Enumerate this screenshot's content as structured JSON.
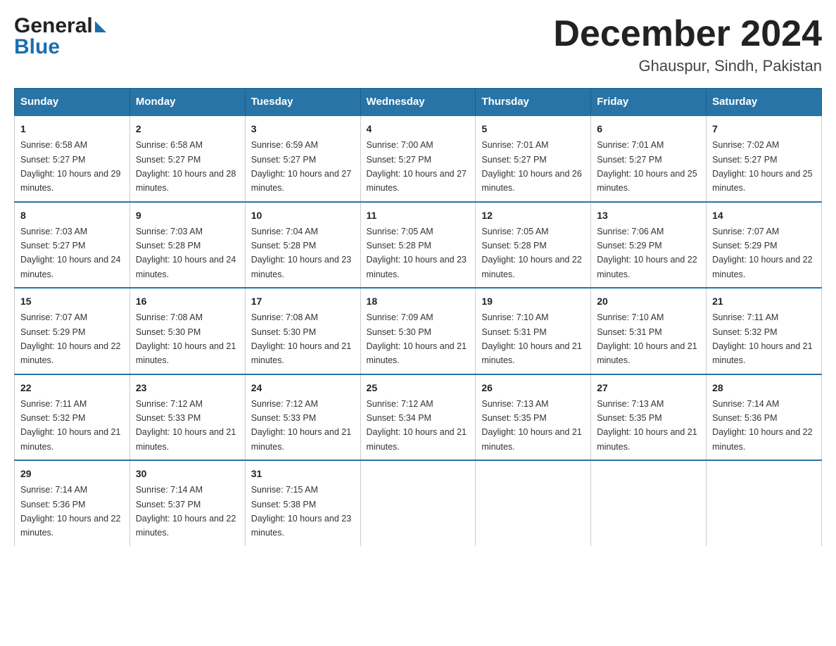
{
  "logo": {
    "general": "General",
    "blue": "Blue"
  },
  "title": "December 2024",
  "subtitle": "Ghauspur, Sindh, Pakistan",
  "days_header": [
    "Sunday",
    "Monday",
    "Tuesday",
    "Wednesday",
    "Thursday",
    "Friday",
    "Saturday"
  ],
  "weeks": [
    [
      {
        "num": "1",
        "sunrise": "6:58 AM",
        "sunset": "5:27 PM",
        "daylight": "10 hours and 29 minutes."
      },
      {
        "num": "2",
        "sunrise": "6:58 AM",
        "sunset": "5:27 PM",
        "daylight": "10 hours and 28 minutes."
      },
      {
        "num": "3",
        "sunrise": "6:59 AM",
        "sunset": "5:27 PM",
        "daylight": "10 hours and 27 minutes."
      },
      {
        "num": "4",
        "sunrise": "7:00 AM",
        "sunset": "5:27 PM",
        "daylight": "10 hours and 27 minutes."
      },
      {
        "num": "5",
        "sunrise": "7:01 AM",
        "sunset": "5:27 PM",
        "daylight": "10 hours and 26 minutes."
      },
      {
        "num": "6",
        "sunrise": "7:01 AM",
        "sunset": "5:27 PM",
        "daylight": "10 hours and 25 minutes."
      },
      {
        "num": "7",
        "sunrise": "7:02 AM",
        "sunset": "5:27 PM",
        "daylight": "10 hours and 25 minutes."
      }
    ],
    [
      {
        "num": "8",
        "sunrise": "7:03 AM",
        "sunset": "5:27 PM",
        "daylight": "10 hours and 24 minutes."
      },
      {
        "num": "9",
        "sunrise": "7:03 AM",
        "sunset": "5:28 PM",
        "daylight": "10 hours and 24 minutes."
      },
      {
        "num": "10",
        "sunrise": "7:04 AM",
        "sunset": "5:28 PM",
        "daylight": "10 hours and 23 minutes."
      },
      {
        "num": "11",
        "sunrise": "7:05 AM",
        "sunset": "5:28 PM",
        "daylight": "10 hours and 23 minutes."
      },
      {
        "num": "12",
        "sunrise": "7:05 AM",
        "sunset": "5:28 PM",
        "daylight": "10 hours and 22 minutes."
      },
      {
        "num": "13",
        "sunrise": "7:06 AM",
        "sunset": "5:29 PM",
        "daylight": "10 hours and 22 minutes."
      },
      {
        "num": "14",
        "sunrise": "7:07 AM",
        "sunset": "5:29 PM",
        "daylight": "10 hours and 22 minutes."
      }
    ],
    [
      {
        "num": "15",
        "sunrise": "7:07 AM",
        "sunset": "5:29 PM",
        "daylight": "10 hours and 22 minutes."
      },
      {
        "num": "16",
        "sunrise": "7:08 AM",
        "sunset": "5:30 PM",
        "daylight": "10 hours and 21 minutes."
      },
      {
        "num": "17",
        "sunrise": "7:08 AM",
        "sunset": "5:30 PM",
        "daylight": "10 hours and 21 minutes."
      },
      {
        "num": "18",
        "sunrise": "7:09 AM",
        "sunset": "5:30 PM",
        "daylight": "10 hours and 21 minutes."
      },
      {
        "num": "19",
        "sunrise": "7:10 AM",
        "sunset": "5:31 PM",
        "daylight": "10 hours and 21 minutes."
      },
      {
        "num": "20",
        "sunrise": "7:10 AM",
        "sunset": "5:31 PM",
        "daylight": "10 hours and 21 minutes."
      },
      {
        "num": "21",
        "sunrise": "7:11 AM",
        "sunset": "5:32 PM",
        "daylight": "10 hours and 21 minutes."
      }
    ],
    [
      {
        "num": "22",
        "sunrise": "7:11 AM",
        "sunset": "5:32 PM",
        "daylight": "10 hours and 21 minutes."
      },
      {
        "num": "23",
        "sunrise": "7:12 AM",
        "sunset": "5:33 PM",
        "daylight": "10 hours and 21 minutes."
      },
      {
        "num": "24",
        "sunrise": "7:12 AM",
        "sunset": "5:33 PM",
        "daylight": "10 hours and 21 minutes."
      },
      {
        "num": "25",
        "sunrise": "7:12 AM",
        "sunset": "5:34 PM",
        "daylight": "10 hours and 21 minutes."
      },
      {
        "num": "26",
        "sunrise": "7:13 AM",
        "sunset": "5:35 PM",
        "daylight": "10 hours and 21 minutes."
      },
      {
        "num": "27",
        "sunrise": "7:13 AM",
        "sunset": "5:35 PM",
        "daylight": "10 hours and 21 minutes."
      },
      {
        "num": "28",
        "sunrise": "7:14 AM",
        "sunset": "5:36 PM",
        "daylight": "10 hours and 22 minutes."
      }
    ],
    [
      {
        "num": "29",
        "sunrise": "7:14 AM",
        "sunset": "5:36 PM",
        "daylight": "10 hours and 22 minutes."
      },
      {
        "num": "30",
        "sunrise": "7:14 AM",
        "sunset": "5:37 PM",
        "daylight": "10 hours and 22 minutes."
      },
      {
        "num": "31",
        "sunrise": "7:15 AM",
        "sunset": "5:38 PM",
        "daylight": "10 hours and 23 minutes."
      },
      null,
      null,
      null,
      null
    ]
  ],
  "labels": {
    "sunrise": "Sunrise: ",
    "sunset": "Sunset: ",
    "daylight": "Daylight: "
  }
}
